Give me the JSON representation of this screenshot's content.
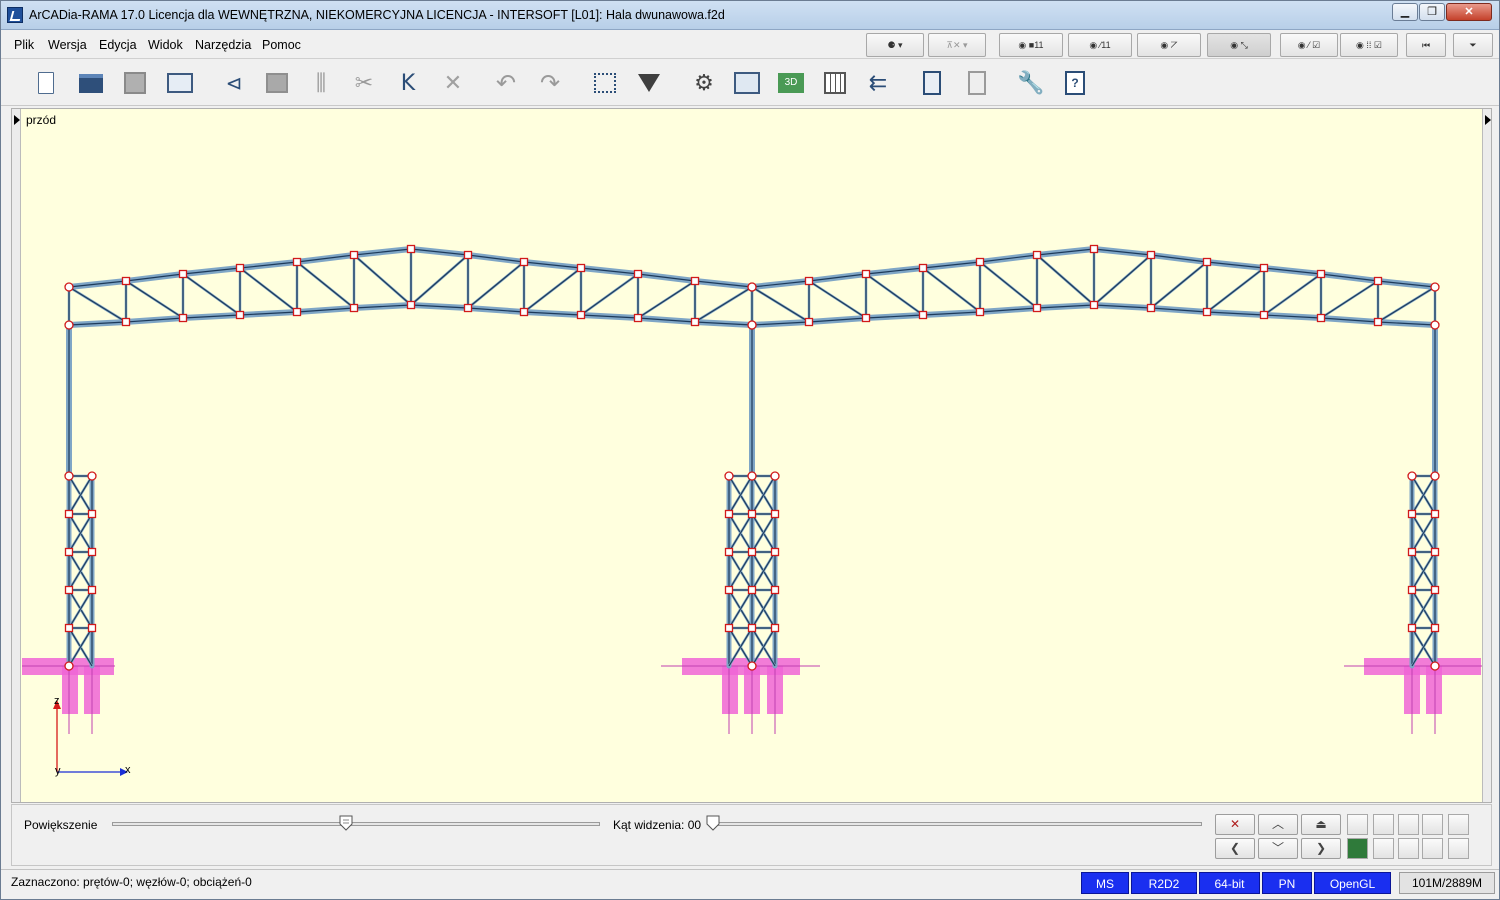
{
  "window": {
    "title": "ArCADia-RAMA 17.0 Licencja dla WEWNĘTRZNA, NIEKOMERCYJNA LICENCJA - INTERSOFT [L01]: Hala dwunawowa.f2d",
    "min_glyph": "▁",
    "max_glyph": "❐",
    "close_glyph": "✕"
  },
  "menu": {
    "items": [
      "Plik",
      "Wersja",
      "Edycja",
      "Widok",
      "Narzędzia",
      "Pomoc"
    ]
  },
  "view_toolbar": {
    "buttons": [
      {
        "icon": "filter-dot-icon",
        "glyph": "⚈ ▾"
      },
      {
        "icon": "support-hide-icon",
        "glyph": "⊼✕ ▾"
      },
      {
        "icon": "show-node-numbers-icon",
        "glyph": "◉ ■11"
      },
      {
        "icon": "show-bar-numbers-icon",
        "glyph": "◉ ⁄11"
      },
      {
        "icon": "show-axes-icon",
        "glyph": "◉ ⦢"
      },
      {
        "icon": "show-loads-icon",
        "glyph": "◉ ⤡"
      },
      {
        "icon": "show-bar-check-icon",
        "glyph": "◉ ⁄ ☑"
      },
      {
        "icon": "show-grid-check-icon",
        "glyph": "◉ ⁞⁞ ☑"
      },
      {
        "icon": "collapse-panel-icon",
        "glyph": "⏮"
      },
      {
        "icon": "menu-dropdown-icon",
        "glyph": "⏷"
      }
    ]
  },
  "toolbar": {
    "buttons": [
      {
        "icon": "new-file-icon"
      },
      {
        "icon": "open-folder-icon"
      },
      {
        "icon": "save-icon"
      },
      {
        "icon": "print-icon"
      },
      {
        "icon": "add-node-icon"
      },
      {
        "icon": "copy-icon"
      },
      {
        "icon": "loads-icon"
      },
      {
        "icon": "cut-icon"
      },
      {
        "icon": "add-bar-icon"
      },
      {
        "icon": "delete-icon"
      },
      {
        "icon": "undo-icon"
      },
      {
        "icon": "redo-icon"
      },
      {
        "icon": "select-window-icon"
      },
      {
        "icon": "filter-icon"
      },
      {
        "icon": "mesh-icon"
      },
      {
        "icon": "section-icon"
      },
      {
        "icon": "view-3d-icon"
      },
      {
        "icon": "table-icon"
      },
      {
        "icon": "results-icon"
      },
      {
        "icon": "calculator-icon"
      },
      {
        "icon": "report-icon"
      },
      {
        "icon": "settings-wrench-icon"
      },
      {
        "icon": "help-icon"
      }
    ]
  },
  "viewport": {
    "view_name": "przód",
    "axis_z": "z",
    "axis_y": "y",
    "axis_x": "x",
    "background": "#ffffde",
    "member_color": "#7fa6c6",
    "node_color": "#d11a1a",
    "support_color": "#f065d6"
  },
  "zoom": {
    "label": "Powiększenie",
    "angle_label": "Kąt widzenia: 00",
    "zoom_level": 0.48,
    "angle_level": 0.0
  },
  "nav": {
    "row1": [
      "✕",
      "︿",
      "⏏"
    ],
    "row2": [
      "❮",
      "﹀",
      "❯"
    ]
  },
  "status": {
    "text": "Zaznaczono: prętów-0; węzłów-0; obciążeń-0",
    "pills": [
      "MS",
      "R2D2",
      "64-bit",
      "PN",
      "OpenGL"
    ],
    "memory": "101M/2889M"
  }
}
